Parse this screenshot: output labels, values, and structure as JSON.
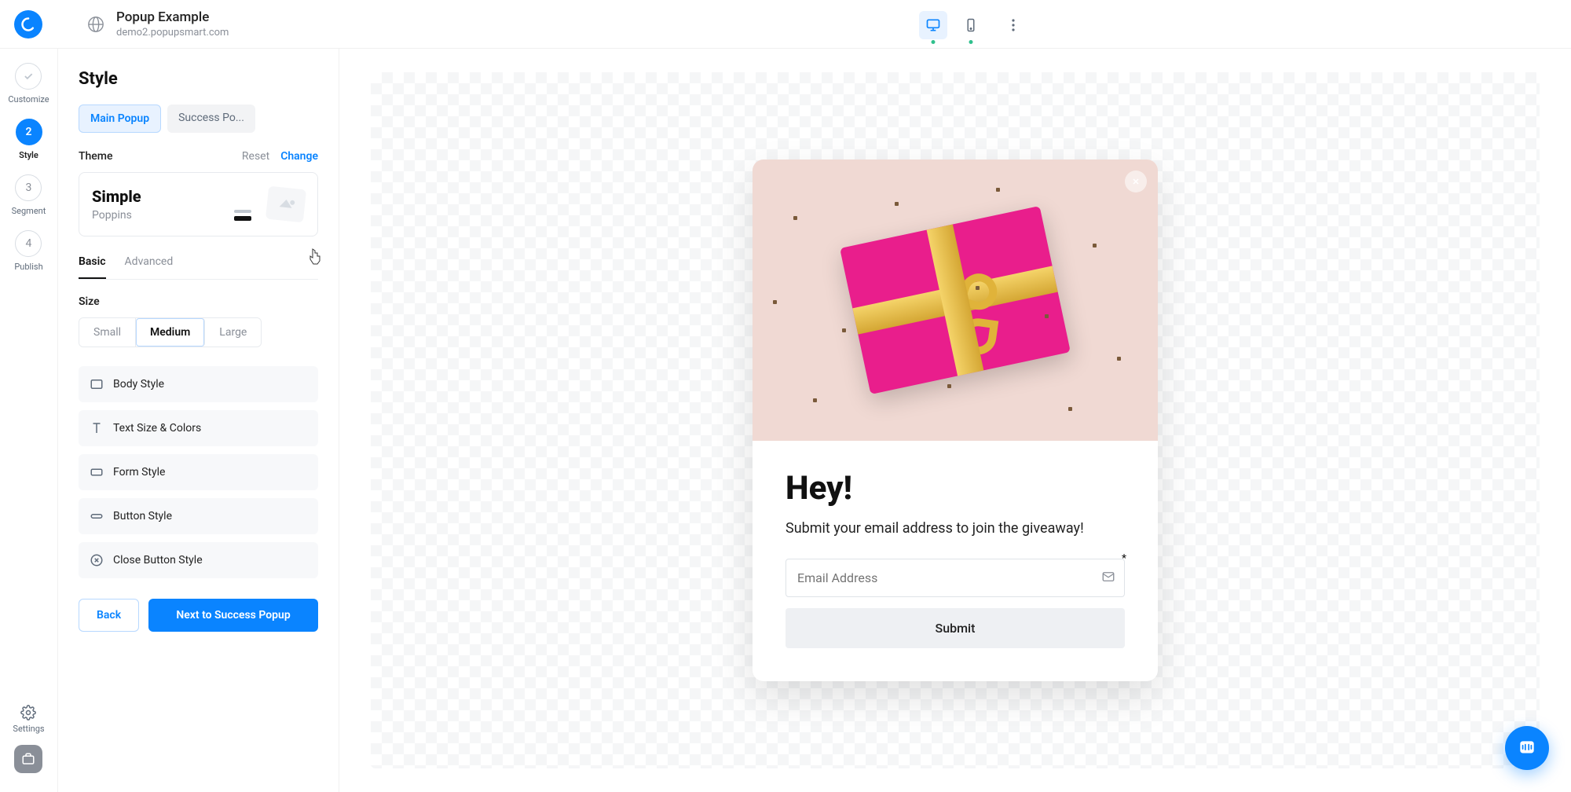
{
  "header": {
    "title": "Popup Example",
    "domain": "demo2.popupsmart.com"
  },
  "rail": {
    "steps": [
      {
        "label": "Customize"
      },
      {
        "num": "2",
        "label": "Style"
      },
      {
        "num": "3",
        "label": "Segment"
      },
      {
        "num": "4",
        "label": "Publish"
      }
    ],
    "settings": "Settings"
  },
  "panel": {
    "title": "Style",
    "popup_tabs": {
      "main": "Main Popup",
      "success": "Success Po..."
    },
    "theme_label": "Theme",
    "theme_reset": "Reset",
    "theme_change": "Change",
    "theme_name": "Simple",
    "theme_font": "Poppins",
    "subtabs": {
      "basic": "Basic",
      "advanced": "Advanced"
    },
    "size_label": "Size",
    "sizes": {
      "small": "Small",
      "medium": "Medium",
      "large": "Large"
    },
    "accordion": {
      "body": "Body Style",
      "text": "Text Size & Colors",
      "form": "Form Style",
      "button": "Button Style",
      "close": "Close Button Style"
    },
    "back": "Back",
    "next": "Next to Success Popup"
  },
  "popup": {
    "headline": "Hey!",
    "subtext": "Submit your email address to join the giveaway!",
    "email_placeholder": "Email Address",
    "submit": "Submit"
  }
}
